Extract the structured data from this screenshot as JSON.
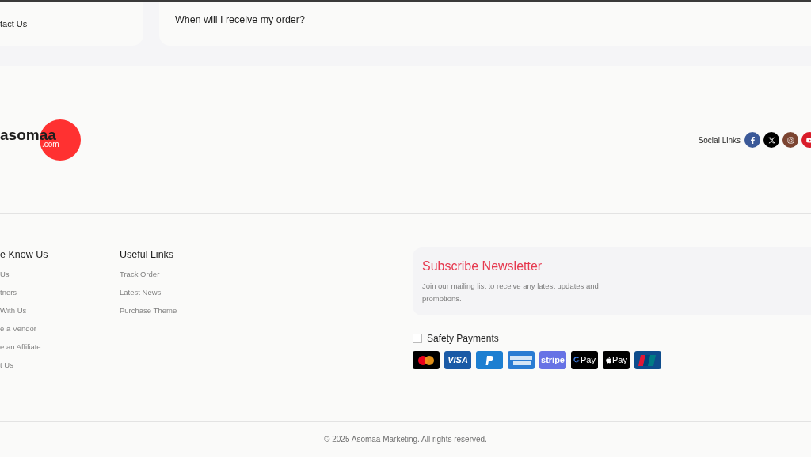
{
  "faq_cards": [
    {
      "text": "tact Us"
    },
    {
      "text": "When will I receive my order?"
    }
  ],
  "logo": {
    "name": "asomaa",
    "suffix": ".com"
  },
  "social": {
    "label": "Social Links",
    "links": [
      {
        "kind": "facebook",
        "color": "#3b5998"
      },
      {
        "kind": "x",
        "color": "#000000"
      },
      {
        "kind": "instagram",
        "color": "#7b4431"
      },
      {
        "kind": "youtube",
        "color": "#d91c2a"
      }
    ]
  },
  "columns": [
    {
      "title": "e Know Us",
      "links": [
        "Us",
        "tners",
        "With Us",
        "e a Vendor",
        "e an Affiliate",
        "t Us"
      ]
    },
    {
      "title": "Useful Links",
      "links": [
        "Track Order",
        "Latest News",
        "Purchase Theme"
      ]
    }
  ],
  "newsletter": {
    "title": "Subscribe Newsletter",
    "text": "Join our mailing list to receive any latest updates and promotions."
  },
  "payments": {
    "label": "Safety Payments",
    "checked": false,
    "methods": [
      {
        "kind": "mastercard"
      },
      {
        "kind": "visa",
        "label": "VISA"
      },
      {
        "kind": "paypal"
      },
      {
        "kind": "amex"
      },
      {
        "kind": "stripe",
        "label": "stripe"
      },
      {
        "kind": "gpay",
        "label": "Pay"
      },
      {
        "kind": "applepay",
        "label": "Pay"
      },
      {
        "kind": "unionpay"
      }
    ]
  },
  "copyright": "© 2025 Asomaa Marketing. All rights reserved."
}
